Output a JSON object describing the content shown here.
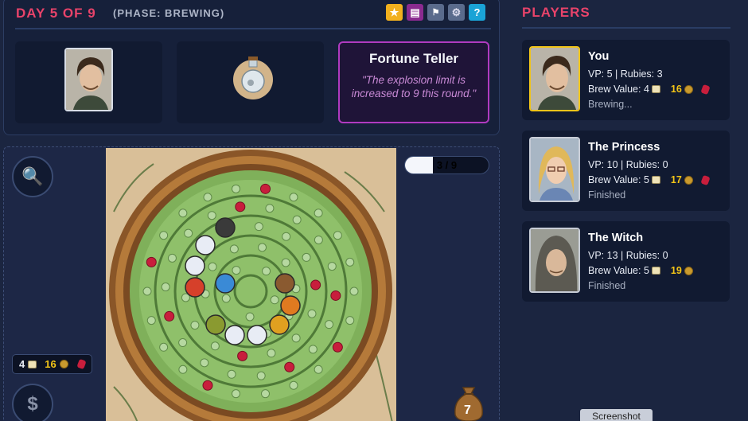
{
  "header": {
    "day_text": "DAY 5 OF 9",
    "phase_text": "(PHASE: BREWING)",
    "icons": [
      "star-icon",
      "book-icon",
      "flag-icon",
      "gear-icon",
      "help-icon"
    ],
    "help_label": "?"
  },
  "event_card": {
    "title": "Fortune Teller",
    "quote": "\"The explosion limit is increased to 9 this round.\""
  },
  "board": {
    "progress_text": "3 / 9",
    "progress_fraction": 0.333,
    "stats": {
      "vp": "4",
      "gold": "16"
    },
    "bag_count": "7"
  },
  "players_title": "PLAYERS",
  "players": [
    {
      "name": "You",
      "vp_line": "VP: 5 | Rubies: 3",
      "brew_label": "Brew Value: 4",
      "gold": "16",
      "has_ruby": true,
      "status": "Brewing...",
      "active": true
    },
    {
      "name": "The Princess",
      "vp_line": "VP: 10 | Rubies: 0",
      "brew_label": "Brew Value: 5",
      "gold": "17",
      "has_ruby": true,
      "status": "Finished",
      "active": false
    },
    {
      "name": "The Witch",
      "vp_line": "VP: 13 | Rubies: 0",
      "brew_label": "Brew Value: 5",
      "gold": "19",
      "has_ruby": false,
      "status": "Finished",
      "active": false
    }
  ],
  "screenshot_label": "Screenshot",
  "colors": {
    "accent": "#e8436a",
    "gold": "#f2c417",
    "event_border": "#b03ac0",
    "active_border": "#f0c419"
  }
}
